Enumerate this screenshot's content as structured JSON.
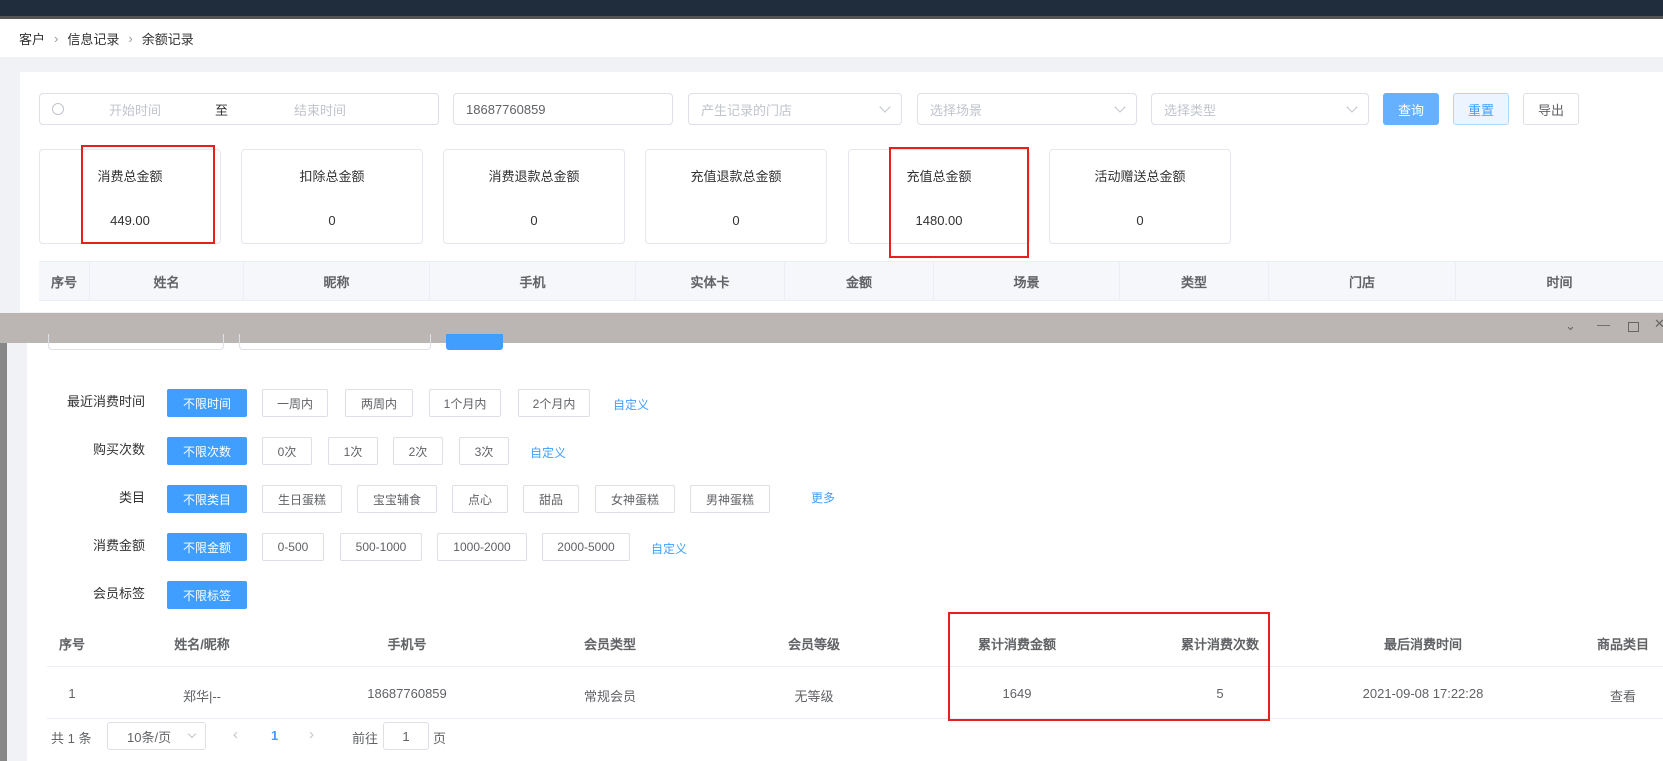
{
  "breadcrumb": [
    "客户",
    "信息记录",
    "余额记录"
  ],
  "filters": {
    "start_placeholder": "开始时间",
    "range_sep": "至",
    "end_placeholder": "结束时间",
    "phone_value": "18687760859",
    "store_placeholder": "产生记录的门店",
    "scene_placeholder": "选择场景",
    "type_placeholder": "选择类型",
    "query_label": "查询",
    "reset_label": "重置",
    "export_label": "导出"
  },
  "cards": [
    {
      "title": "消费总金额",
      "value": "449.00"
    },
    {
      "title": "扣除总金额",
      "value": "0"
    },
    {
      "title": "消费退款总金额",
      "value": "0"
    },
    {
      "title": "充值退款总金额",
      "value": "0"
    },
    {
      "title": "充值总金额",
      "value": "1480.00"
    },
    {
      "title": "活动赠送总金额",
      "value": "0"
    }
  ],
  "table1": {
    "columns": [
      "序号",
      "姓名",
      "昵称",
      "手机",
      "实体卡",
      "金额",
      "场景",
      "类型",
      "门店",
      "时间"
    ]
  },
  "window_controls": [
    "chevron-down-icon",
    "minimize-icon",
    "maximize-icon",
    "close-icon"
  ],
  "member_filters": {
    "recent": {
      "label": "最近消费时间",
      "options": [
        "不限时间",
        "一周内",
        "两周内",
        "1个月内",
        "2个月内"
      ],
      "custom": "自定义"
    },
    "count": {
      "label": "购买次数",
      "options": [
        "不限次数",
        "0次",
        "1次",
        "2次",
        "3次"
      ],
      "custom": "自定义"
    },
    "category": {
      "label": "类目",
      "options": [
        "不限类目",
        "生日蛋糕",
        "宝宝辅食",
        "点心",
        "甜品",
        "女神蛋糕",
        "男神蛋糕"
      ],
      "more": "更多"
    },
    "amount": {
      "label": "消费金额",
      "options": [
        "不限金额",
        "0-500",
        "500-1000",
        "1000-2000",
        "2000-5000"
      ],
      "custom": "自定义"
    },
    "tag": {
      "label": "会员标签",
      "options": [
        "不限标签"
      ]
    }
  },
  "table2": {
    "columns": [
      "序号",
      "姓名/昵称",
      "手机号",
      "会员类型",
      "会员等级",
      "累计消费金额",
      "累计消费次数",
      "最后消费时间",
      "商品类目"
    ],
    "rows": [
      [
        "1",
        "郑华|--",
        "18687760859",
        "常规会员",
        "无等级",
        "1649",
        "5",
        "2021-09-08 17:22:28",
        "查看"
      ]
    ]
  },
  "pagination": {
    "total": "共 1 条",
    "page_size": "10条/页",
    "current": "1",
    "goto_prefix": "前往",
    "goto_value": "1",
    "goto_suffix": "页"
  },
  "colors": {
    "primary": "#409eff",
    "highlight": "#e8201c"
  }
}
